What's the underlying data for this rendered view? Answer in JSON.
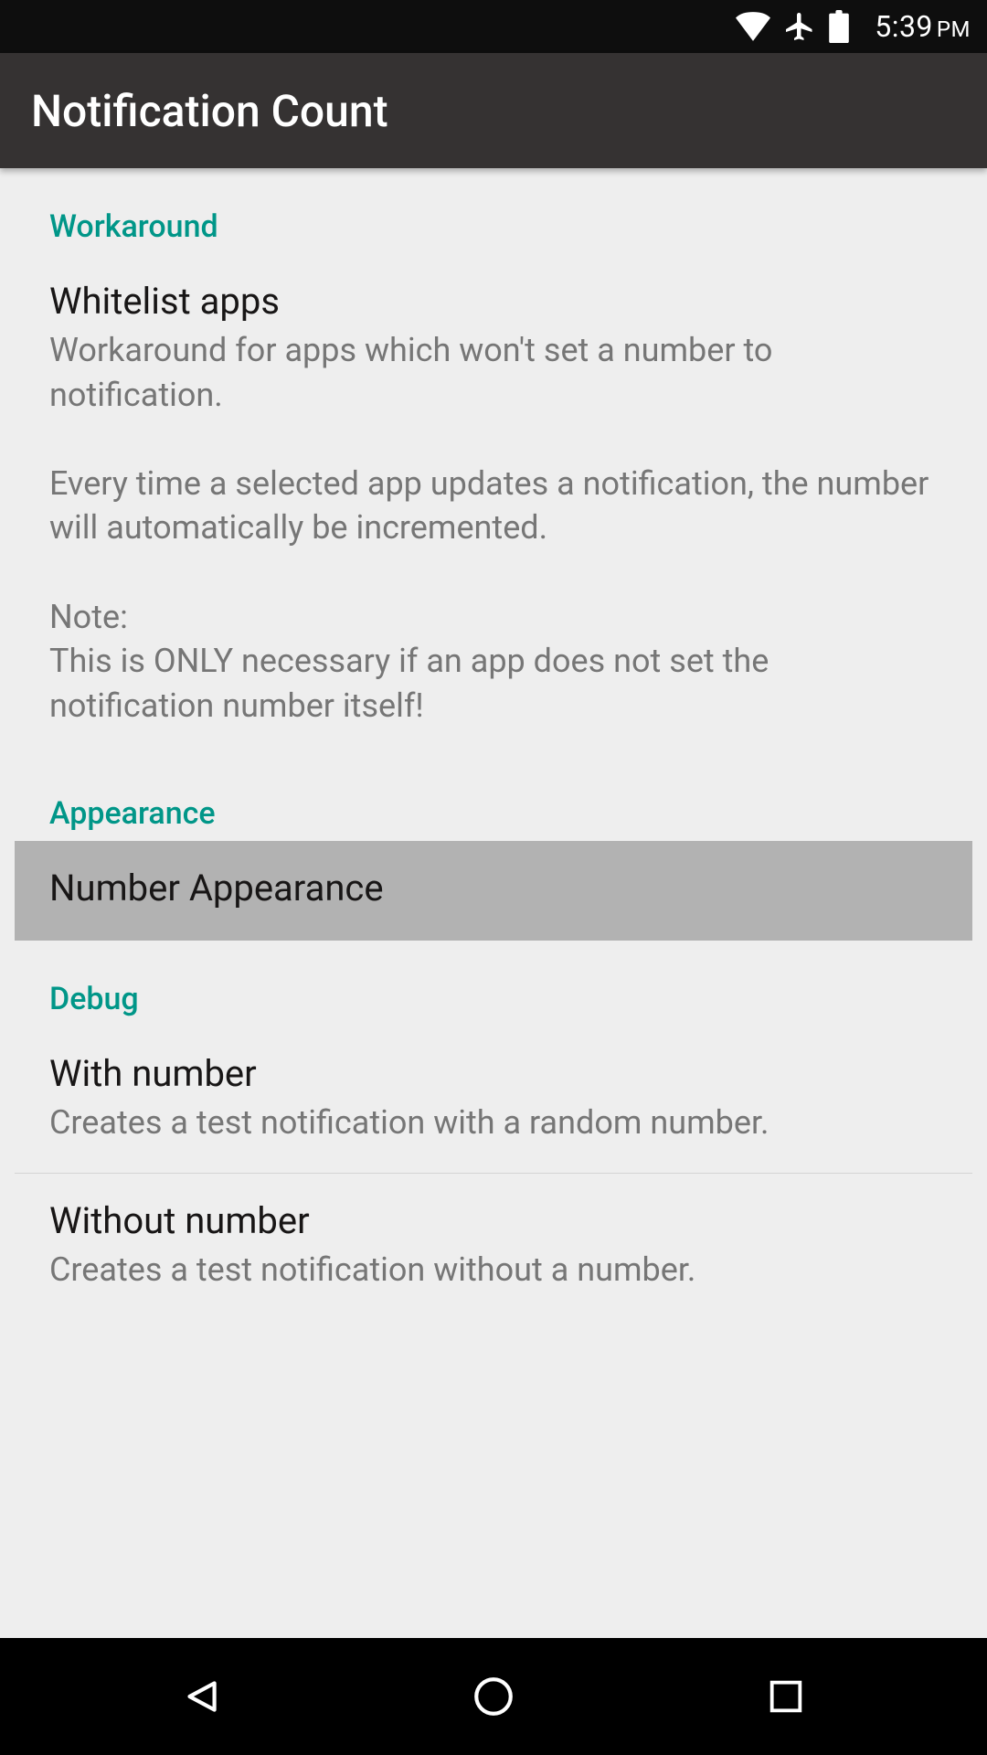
{
  "status_bar": {
    "time": "5:39",
    "ampm": "PM"
  },
  "app_bar": {
    "title": "Notification Count"
  },
  "sections": {
    "workaround": {
      "header": "Workaround",
      "whitelist": {
        "title": "Whitelist apps",
        "summary": "Workaround for apps which won't set a number to notification.\n\nEvery time a selected app updates a notification, the number will automatically be incremented.\n\nNote:\nThis is ONLY necessary if an app does not set the notification number itself!"
      }
    },
    "appearance": {
      "header": "Appearance",
      "number_appearance": {
        "title": "Number Appearance"
      }
    },
    "debug": {
      "header": "Debug",
      "with_number": {
        "title": "With number",
        "summary": "Creates a test notification with a random number."
      },
      "without_number": {
        "title": "Without number",
        "summary": "Creates a test notification without a number."
      }
    }
  }
}
